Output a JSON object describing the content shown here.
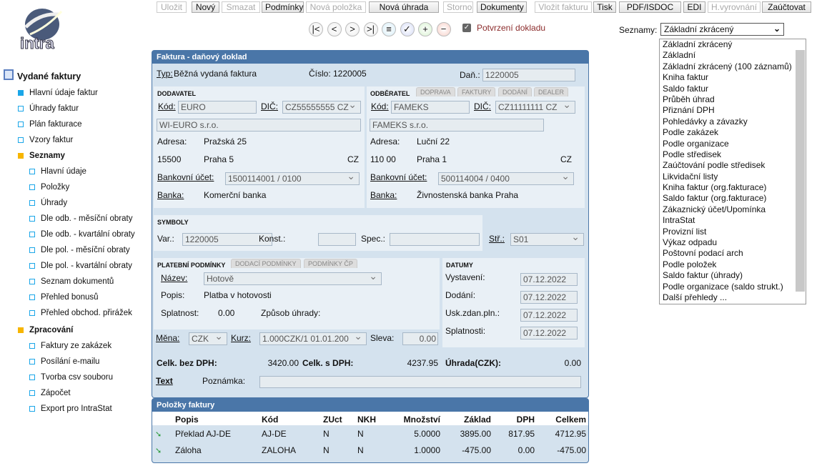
{
  "toolbar": [
    "Uložit",
    "Nový",
    "Smazat",
    "Podmínky",
    "Nová položka",
    "Nová úhrada",
    "Storno",
    "Dokumenty",
    "Vložit fakturu",
    "Tisk",
    "PDF/ISDOC",
    "EDI",
    "H.vyrovnání",
    "Zaúčtovat"
  ],
  "toolbar_disabled": [
    true,
    false,
    true,
    false,
    true,
    false,
    true,
    false,
    true,
    false,
    false,
    false,
    true,
    false
  ],
  "nav_icons": [
    "first-icon",
    "prev-icon",
    "next-icon",
    "last-icon",
    "list-icon",
    "confirm-icon",
    "add-icon",
    "remove-icon"
  ],
  "nav_glyphs": [
    "|<",
    "<",
    ">",
    ">|",
    "≡",
    "✓",
    "+",
    "−"
  ],
  "confirm": {
    "label": "Potvrzení dokladu",
    "checked": true
  },
  "logo": "intra",
  "seznamy": {
    "label": "Seznamy:",
    "value": "Základní zkrácený",
    "options": [
      "Základní zkrácený",
      "Základní",
      "Základní zkrácený (100 záznamů)",
      "Kniha faktur",
      "Saldo faktur",
      "Průběh úhrad",
      "Přiznání DPH",
      "Pohledávky a závazky",
      "Podle zakázek",
      "Podle organizace",
      "Podle středisek",
      "Zaúčtování podle středisek",
      "Likvidační listy",
      "Kniha faktur (org.fakturace)",
      "Saldo faktur (org.fakturace)",
      "Zákaznický účet/Upomínka",
      "IntraStat",
      "Provizní list",
      "Výkaz odpadu",
      "Poštovní podací arch",
      "Podle položek",
      "Saldo faktur (úhrady)",
      "Podle organizace (saldo strukt.)",
      "Další přehledy ..."
    ]
  },
  "sidebar": {
    "title": "Vydané faktury",
    "items": [
      {
        "label": "Hlavní údaje faktur",
        "level": 1,
        "type": "active"
      },
      {
        "label": "Úhrady faktur",
        "level": 1,
        "type": "item"
      },
      {
        "label": "Plán fakturace",
        "level": 1,
        "type": "item"
      },
      {
        "label": "Vzory faktur",
        "level": 1,
        "type": "item"
      },
      {
        "label": "Seznamy",
        "level": 1,
        "type": "folder"
      },
      {
        "label": "Hlavní údaje",
        "level": 2,
        "type": "item"
      },
      {
        "label": "Položky",
        "level": 2,
        "type": "item"
      },
      {
        "label": "Úhrady",
        "level": 2,
        "type": "item"
      },
      {
        "label": "Dle odb. - měsíční obraty",
        "level": 2,
        "type": "item"
      },
      {
        "label": "Dle odb. - kvartální obraty",
        "level": 2,
        "type": "item"
      },
      {
        "label": "Dle pol. - měsíční obraty",
        "level": 2,
        "type": "item"
      },
      {
        "label": "Dle pol. - kvartální obraty",
        "level": 2,
        "type": "item"
      },
      {
        "label": "Seznam dokumentů",
        "level": 2,
        "type": "item"
      },
      {
        "label": "Přehled bonusů",
        "level": 2,
        "type": "item"
      },
      {
        "label": "Přehled obchod. přirážek",
        "level": 2,
        "type": "item"
      },
      {
        "label": "Zpracování",
        "level": 1,
        "type": "folder"
      },
      {
        "label": "Faktury ze zakázek",
        "level": 2,
        "type": "item"
      },
      {
        "label": "Posílání e-mailu",
        "level": 2,
        "type": "item"
      },
      {
        "label": "Tvorba csv souboru",
        "level": 2,
        "type": "item"
      },
      {
        "label": "Zápočet",
        "level": 2,
        "type": "item"
      },
      {
        "label": "Export pro IntraStat",
        "level": 2,
        "type": "item"
      }
    ]
  },
  "form": {
    "title": "Faktura - daňový doklad",
    "typ_label": "Typ:",
    "typ": "Běžná vydaná faktura",
    "cislo": "Číslo: 1220005",
    "dan_label": "Daň.:",
    "dan": "1220005",
    "dodavatel": {
      "caption": "DODAVATEL",
      "kod_label": "Kód:",
      "kod": "EURO",
      "dic_label": "DIČ:",
      "dic": "CZ55555555 CZ",
      "name": "WI-EURO s.r.o.",
      "adresa_label": "Adresa:",
      "adresa": "Pražská 25",
      "psc": "15500",
      "mesto": "Praha 5",
      "stat": "CZ",
      "ucet_label": "Bankovní účet:",
      "ucet": "1500114001 / 0100",
      "banka_label": "Banka:",
      "banka": "Komerční banka"
    },
    "odberatel": {
      "caption": "ODBĚRATEL",
      "tabs": [
        "DOPRAVA",
        "FAKTURY",
        "DODÁNÍ",
        "DEALER"
      ],
      "kod_label": "Kód:",
      "kod": "FAMEKS",
      "dic_label": "DIČ:",
      "dic": "CZ11111111 CZ",
      "name": "FAMEKS s.r.o.",
      "adresa_label": "Adresa:",
      "adresa": "Luční 22",
      "psc": "110 00",
      "mesto": "Praha 1",
      "stat": "CZ",
      "ucet_label": "Bankovní účet:",
      "ucet": "500114004 / 0400",
      "banka_label": "Banka:",
      "banka": "Živnostenská banka Praha"
    },
    "symboly": {
      "caption": "SYMBOLY",
      "var_label": "Var.:",
      "var": "1220005",
      "konst_label": "Konst.:",
      "konst": "",
      "spec_label": "Spec.:",
      "spec": "",
      "str_label": "Stř.:",
      "str": "S01"
    },
    "platebni": {
      "caption": "PLATEBNÍ PODMÍNKY",
      "tabs": [
        "DODACÍ PODMÍNKY",
        "PODMÍNKY ČP"
      ],
      "nazev_label": "Název:",
      "nazev": "Hotově",
      "popis_label": "Popis:",
      "popis": "Platba v hotovosti",
      "splatnost_label": "Splatnost:",
      "splatnost": "0.00",
      "zpusob_label": "Způsob úhrady:"
    },
    "datumy": {
      "caption": "DATUMY",
      "rows": [
        {
          "label": "Vystavení:",
          "value": "07.12.2022"
        },
        {
          "label": "Dodání:",
          "value": "07.12.2022"
        },
        {
          "label": "Usk.zdan.pln.:",
          "value": "07.12.2022"
        },
        {
          "label": "Splatnosti:",
          "value": "07.12.2022"
        }
      ]
    },
    "mena_label": "Měna:",
    "mena": "CZK",
    "kurz_label": "Kurz:",
    "kurz": "1.000CZK/1   01.01.200",
    "sleva_label": "Sleva:",
    "sleva": "0.00",
    "bez_dph_label": "Celk. bez DPH:",
    "bez_dph": "3420.00",
    "s_dph_label": "Celk. s DPH:",
    "s_dph": "4237.95",
    "uhrada_label": "Úhrada(CZK):",
    "uhrada": "0.00",
    "text_label": "Text",
    "poznamka_label": "Poznámka:",
    "poznamka": ""
  },
  "items": {
    "title": "Položky faktury",
    "columns": [
      "Popis",
      "Kód",
      "ZUct",
      "NKH",
      "Množství",
      "Základ",
      "DPH",
      "Celkem"
    ],
    "rows": [
      [
        "Překlad AJ-DE",
        "AJ-DE",
        "N",
        "N",
        "5.0000",
        "3895.00",
        "817.95",
        "4712.95"
      ],
      [
        "Záloha",
        "ZALOHA",
        "N",
        "N",
        "1.0000",
        "-475.00",
        "0.00",
        "-475.00"
      ]
    ]
  }
}
